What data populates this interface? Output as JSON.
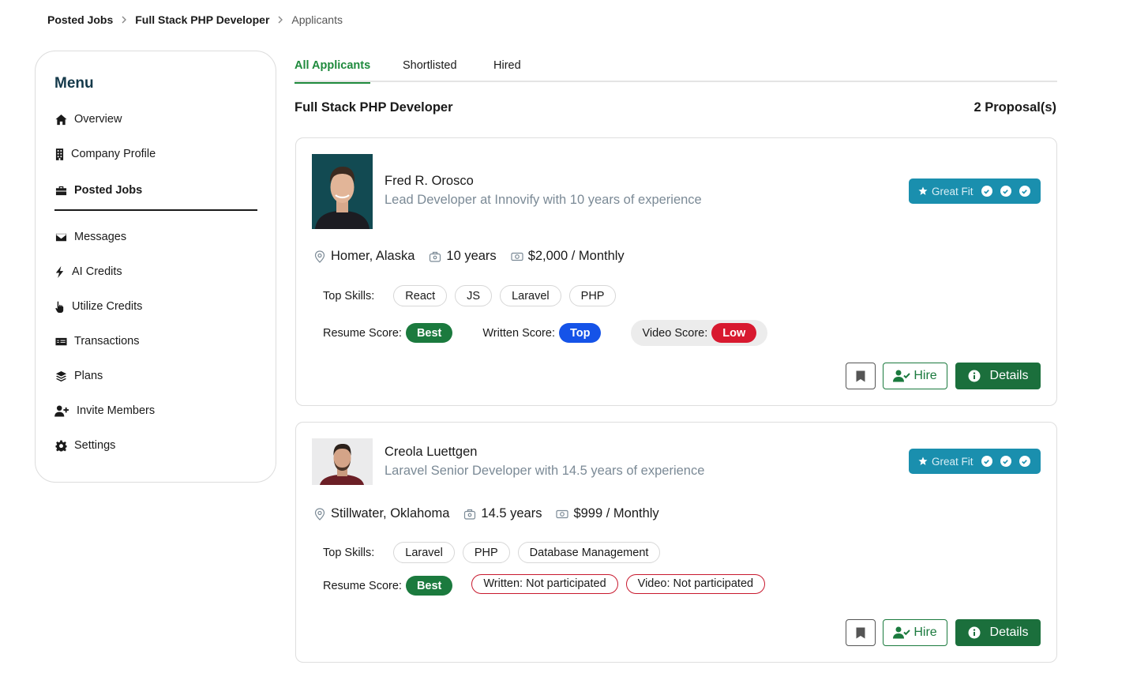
{
  "breadcrumb": {
    "items": [
      "Posted Jobs",
      "Full Stack PHP Developer",
      "Applicants"
    ]
  },
  "sidebar": {
    "title": "Menu",
    "items": [
      {
        "label": "Overview",
        "icon": "home-icon"
      },
      {
        "label": "Company Profile",
        "icon": "building-icon"
      },
      {
        "label": "Posted Jobs",
        "icon": "briefcase-icon",
        "active": true
      },
      {
        "label": "Messages",
        "icon": "envelope-icon"
      },
      {
        "label": "AI Credits",
        "icon": "bolt-icon"
      },
      {
        "label": "Utilize Credits",
        "icon": "hand-pointer-icon"
      },
      {
        "label": "Transactions",
        "icon": "money-check-icon"
      },
      {
        "label": "Plans",
        "icon": "layers-icon"
      },
      {
        "label": "Invite Members",
        "icon": "user-plus-icon"
      },
      {
        "label": "Settings",
        "icon": "gear-icon"
      }
    ]
  },
  "tabs": [
    "All Applicants",
    "Shortlisted",
    "Hired"
  ],
  "job": {
    "title": "Full Stack PHP Developer",
    "proposals": "2 Proposal(s)"
  },
  "labels": {
    "great_fit": "Great Fit",
    "top_skills": "Top Skills:",
    "resume_score": "Resume Score:",
    "written_score": "Written Score:",
    "video_score": "Video Score:",
    "hire": "Hire",
    "details": "Details"
  },
  "applicants": [
    {
      "name": "Fred R. Orosco",
      "headline": "Lead Developer at Innovify with 10 years of experience",
      "location": "Homer, Alaska",
      "experience": "10 years",
      "rate": "$2,000 / Monthly",
      "skills": [
        "React",
        "JS",
        "Laravel",
        "PHP"
      ],
      "resume_score": "Best",
      "written_score": "Top",
      "video_score": "Low"
    },
    {
      "name": "Creola Luettgen",
      "headline": "Laravel Senior Developer with 14.5 years of experience",
      "location": "Stillwater, Oklahoma",
      "experience": "14.5 years",
      "rate": "$999 / Monthly",
      "skills": [
        "Laravel",
        "PHP",
        "Database Management"
      ],
      "resume_score": "Best",
      "written_status": "Written: Not participated",
      "video_status": "Video: Not participated"
    }
  ],
  "colors": {
    "accent_green": "#1b7a3e",
    "great_fit_blue": "#1a8fae",
    "top_blue": "#1553e8",
    "low_red": "#d8192f",
    "menu_title": "#14394a"
  }
}
